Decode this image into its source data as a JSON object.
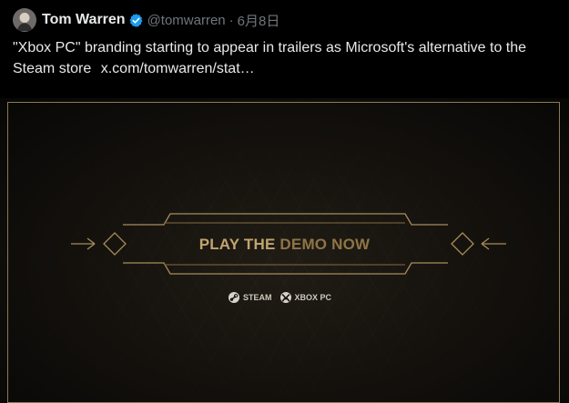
{
  "tweet": {
    "author_name": "Tom Warren",
    "handle": "@tomwarren",
    "separator": "·",
    "date": "6月8日",
    "text": "\"Xbox PC\" branding starting to appear in trailers as Microsoft's alternative to the Steam store",
    "link_text": "x.com/tomwarren/stat…"
  },
  "media": {
    "cta_part1": "PLAY THE",
    "cta_part2": " DEMO NOW",
    "steam_label": "STEAM",
    "xbox_label": "XBOX PC",
    "colors": {
      "gold": "#a98c58",
      "frame": "#8d7a56",
      "background": "#0a0908"
    }
  },
  "icons": {
    "avatar": "avatar",
    "verified": "verified-badge-icon",
    "steam": "steam-logo-icon",
    "xbox": "xbox-logo-icon"
  }
}
